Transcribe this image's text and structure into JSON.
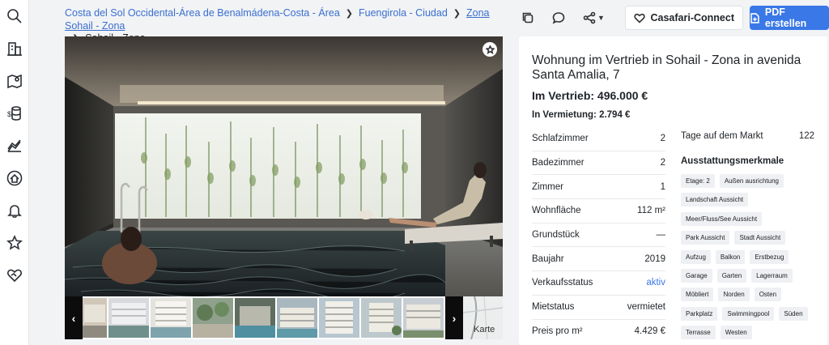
{
  "breadcrumb": {
    "items": [
      "Costa del Sol Occidental-Área de Benalmádena-Costa - Área",
      "Fuengirola - Ciudad",
      "Zona Sohail - Zona",
      "Sohail - Zona"
    ]
  },
  "sidebar": {
    "icons": [
      "search-icon",
      "buildings-icon",
      "map-pin-icon",
      "coin-database-icon",
      "area-chart-icon",
      "home-alert-icon",
      "bell-icon",
      "star-icon",
      "handshake-heart-icon"
    ]
  },
  "toolbar": {
    "casafari_connect": "Casafari-Connect",
    "pdf_button": "PDF erstellen"
  },
  "gallery": {
    "map_label": "Karte",
    "prev": "‹",
    "next": "›"
  },
  "listing": {
    "title": "Wohnung im Vertrieb in Sohail - Zona in avenida Santa Amalia, 7",
    "sale_price": "Im Vertrieb: 496.000 €",
    "rent_price": "In Vermietung: 2.794 €",
    "facts": [
      {
        "label": "Schlafzimmer",
        "value": "2"
      },
      {
        "label": "Badezimmer",
        "value": "2"
      },
      {
        "label": "Zimmer",
        "value": "1"
      },
      {
        "label": "Wohnfläche",
        "value": "112 m²"
      },
      {
        "label": "Grundstück",
        "value": "—"
      },
      {
        "label": "Baujahr",
        "value": "2019"
      },
      {
        "label": "Verkaufsstatus",
        "value": "aktiv"
      },
      {
        "label": "Mietstatus",
        "value": "vermietet"
      },
      {
        "label": "Preis pro m²",
        "value": "4.429 €"
      }
    ],
    "days_on_market_label": "Tage auf dem Markt",
    "days_on_market_value": "122",
    "features_title": "Ausstattungsmerkmale",
    "features": [
      [
        "Etage: 2",
        "Außen ausrichtung"
      ],
      [
        "Landschaft Aussicht"
      ],
      [
        "Meer/Fluss/See Aussicht"
      ],
      [
        "Park Aussicht",
        "Stadt Aussicht"
      ],
      [
        "Aufzug",
        "Balkon",
        "Erstbezug"
      ],
      [
        "Garage",
        "Garten",
        "Lagerraum"
      ],
      [
        "Möbliert",
        "Norden",
        "Osten"
      ],
      [
        "Parkplatz",
        "Swimmingpool",
        "Süden"
      ],
      [
        "Terrasse",
        "Westen"
      ]
    ]
  },
  "colors": {
    "accent": "#3a78e7",
    "link": "#3a6fd0"
  }
}
